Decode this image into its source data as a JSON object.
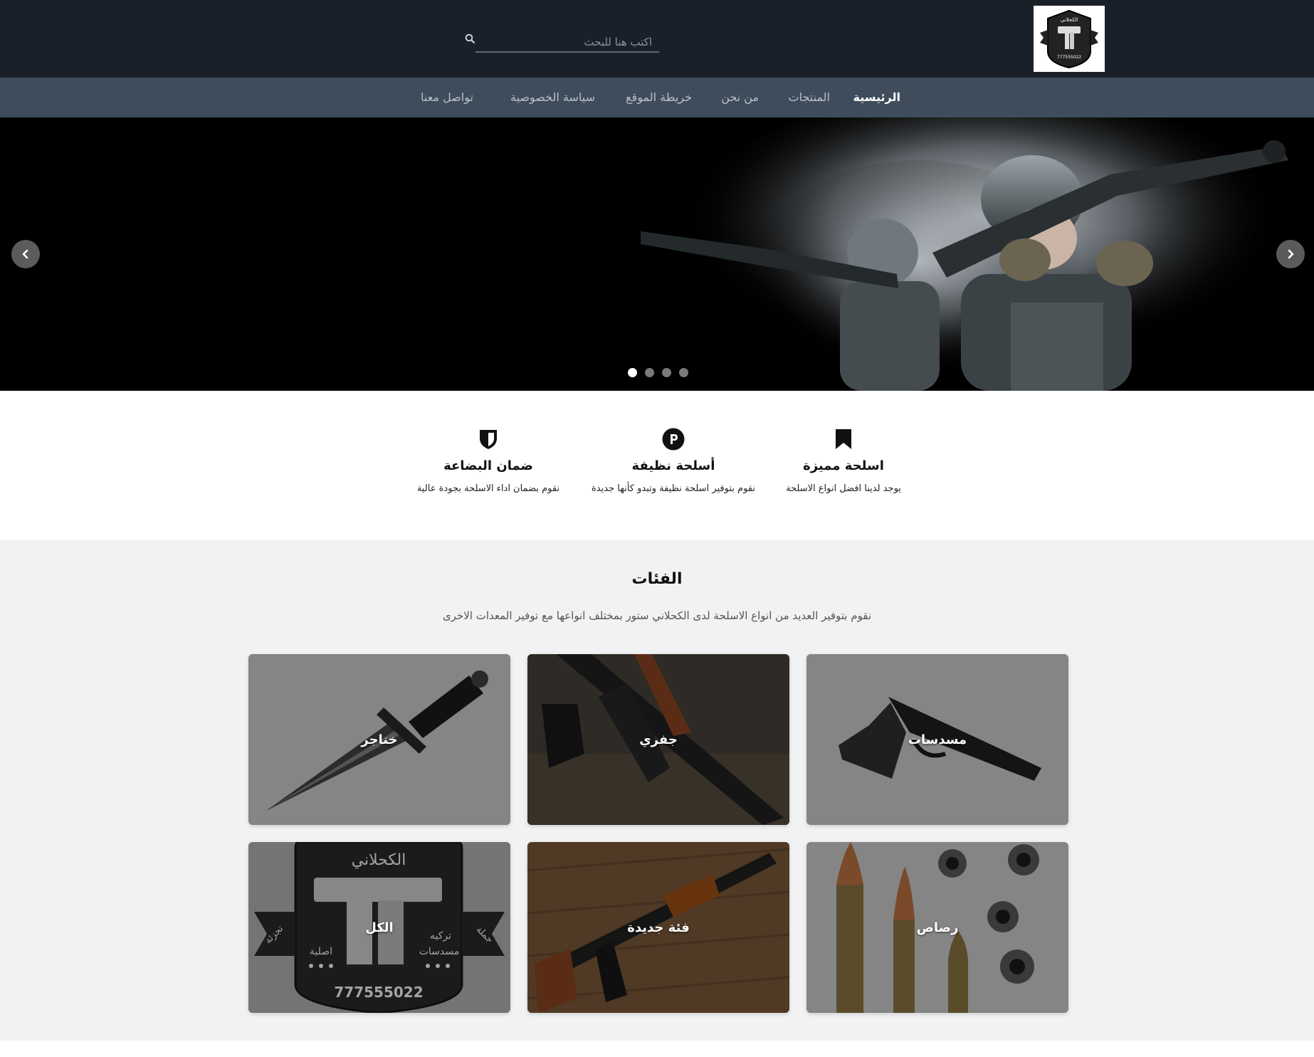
{
  "brand": {
    "logo_text_top": "الكحلاني",
    "logo_phone": "777555022",
    "logo_side_left": "تجزئة",
    "logo_side_right": "جملة"
  },
  "search": {
    "placeholder": "اكتب هنا للبحث",
    "icon": "search-icon"
  },
  "nav": {
    "items": [
      {
        "label": "الرئيسية",
        "active": true
      },
      {
        "label": "المنتجات"
      },
      {
        "label": "من نحن"
      },
      {
        "label": "خريطة الموقع"
      },
      {
        "label": "سياسة الخصوصية"
      },
      {
        "label": "تواصل معنا"
      }
    ]
  },
  "slider": {
    "prev_icon": "chevron-left-icon",
    "next_icon": "chevron-right-icon",
    "dots": 4,
    "active_dot": 1
  },
  "features": [
    {
      "icon": "bookmark-icon",
      "title": "اسلحة مميزة",
      "text": "يوجد لدينا افضل انواع الاسلحة"
    },
    {
      "icon": "parking-circle-icon",
      "title": "أسلحة نظيفة",
      "text": "نقوم بتوفير اسلحة نظيفة وتبدو كأنها جديدة"
    },
    {
      "icon": "shield-icon",
      "title": "ضمان البضاعة",
      "text": "نقوم بضمان اداء الاسلحة بجودة عالية"
    }
  ],
  "categories": {
    "title": "الفئات",
    "subtitle": "نقوم بتوفير العديد من انواع الاسلحة لدى الكحلاني ستور بمختلف انواعها مع توفير المعدات الاخرى",
    "items": [
      {
        "label": "مسدسات"
      },
      {
        "label": "جفري"
      },
      {
        "label": "خناجر"
      },
      {
        "label": "رصاص"
      },
      {
        "label": "فئة جديدة"
      },
      {
        "label": "الكل"
      }
    ],
    "logo_card": {
      "left_words": [
        "تركيه",
        "مسدسات"
      ],
      "right_words": [
        "اصلية"
      ]
    }
  },
  "colors": {
    "header": "#1a2029",
    "nav": "#3e4c5b",
    "section_bg": "#f1f2f4"
  }
}
